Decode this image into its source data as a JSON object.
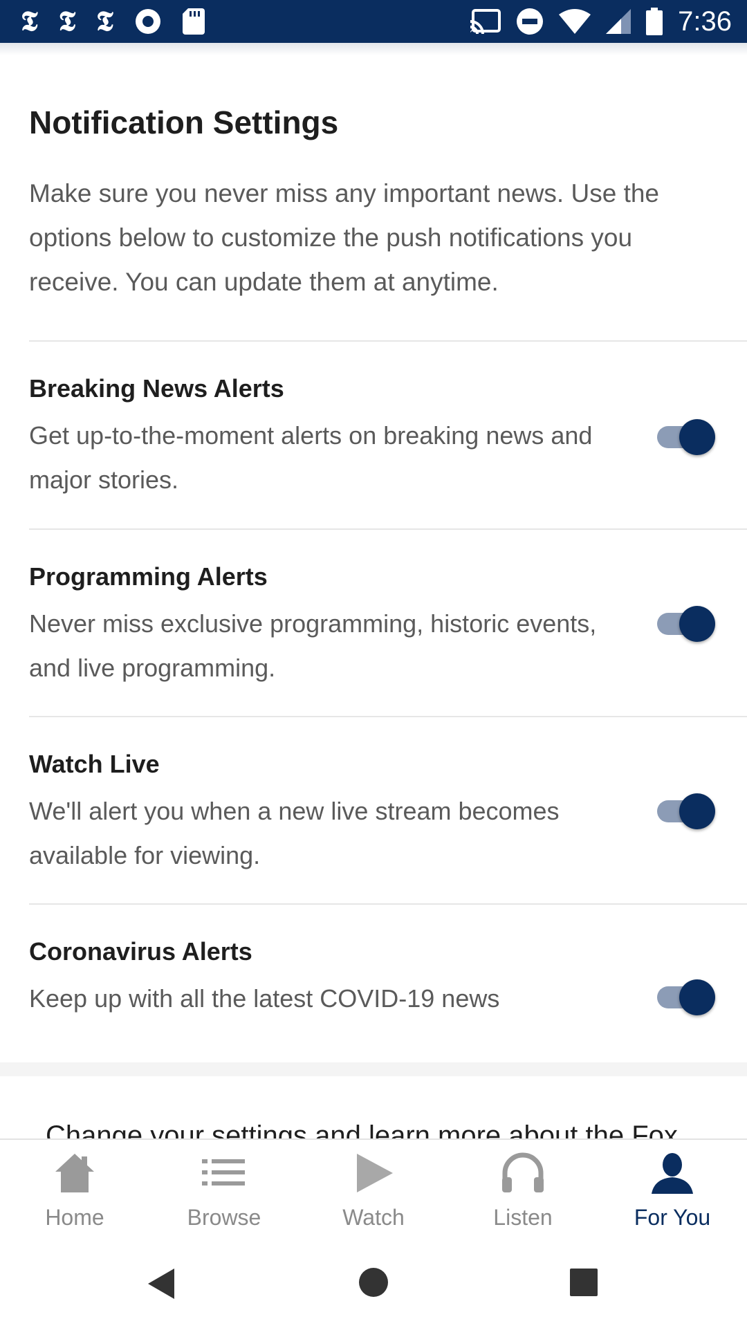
{
  "status_bar": {
    "time": "7:36",
    "left_icons": [
      "nyt-logo-icon",
      "nyt-logo-icon",
      "nyt-logo-icon",
      "record-icon",
      "sd-card-icon"
    ],
    "right_icons": [
      "cast-icon",
      "do-not-disturb-icon",
      "wifi-icon",
      "signal-icon",
      "battery-icon"
    ]
  },
  "page": {
    "title": "Notification Settings",
    "intro": "Make sure you never miss any important news. Use the options below to customize the push notifications you receive. You can update them at anytime."
  },
  "settings": [
    {
      "title": "Breaking News Alerts",
      "description": "Get up-to-the-moment alerts on breaking news and major stories.",
      "enabled": true
    },
    {
      "title": "Programming Alerts",
      "description": "Never miss exclusive programming, historic events, and live programming.",
      "enabled": true
    },
    {
      "title": "Watch Live",
      "description": "We'll alert you when a new live stream becomes available for viewing.",
      "enabled": true
    },
    {
      "title": "Coronavirus Alerts",
      "description": "Keep up with all the latest COVID-19 news",
      "enabled": true
    }
  ],
  "footer": {
    "text": "Change your settings and learn more about the Fox"
  },
  "bottom_nav": {
    "items": [
      {
        "label": "Home",
        "icon": "home-icon",
        "active": false
      },
      {
        "label": "Browse",
        "icon": "list-icon",
        "active": false
      },
      {
        "label": "Watch",
        "icon": "play-icon",
        "active": false
      },
      {
        "label": "Listen",
        "icon": "headphones-icon",
        "active": false
      },
      {
        "label": "For You",
        "icon": "person-icon",
        "active": true
      }
    ]
  },
  "colors": {
    "status_bar": "#0a2d5f",
    "accent": "#0a2d5f",
    "toggle_track": "#8c9cb6",
    "inactive_nav": "#8a8a8a"
  }
}
